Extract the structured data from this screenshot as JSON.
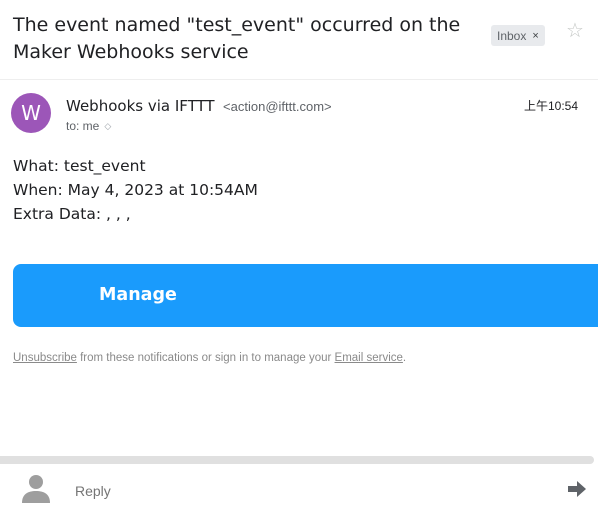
{
  "email": {
    "subject": "The event named \"test_event\" occurred on the Maker Webhooks service",
    "label_chip": "Inbox",
    "label_chip_remove": "×",
    "star_icon": "star-outline",
    "sender": {
      "avatar_letter": "W",
      "avatar_color": "#9c56b8",
      "name": "Webhooks via IFTTT",
      "email": "<action@ifttt.com>",
      "to": "to: me",
      "time": "上午10:54"
    },
    "body": {
      "what": "What: test_event",
      "when": "When: May 4, 2023 at 10:54AM",
      "extra": "Extra Data: , , ,"
    },
    "cta": {
      "label": "Manage",
      "color": "#1a9bfc"
    },
    "footer": {
      "unsubscribe": "Unsubscribe",
      "middle": " from these notifications or sign in to manage your ",
      "service_link": "Email service",
      "end": "."
    }
  },
  "reply_bar": {
    "placeholder": "Reply",
    "forward_icon": "forward-arrow"
  }
}
